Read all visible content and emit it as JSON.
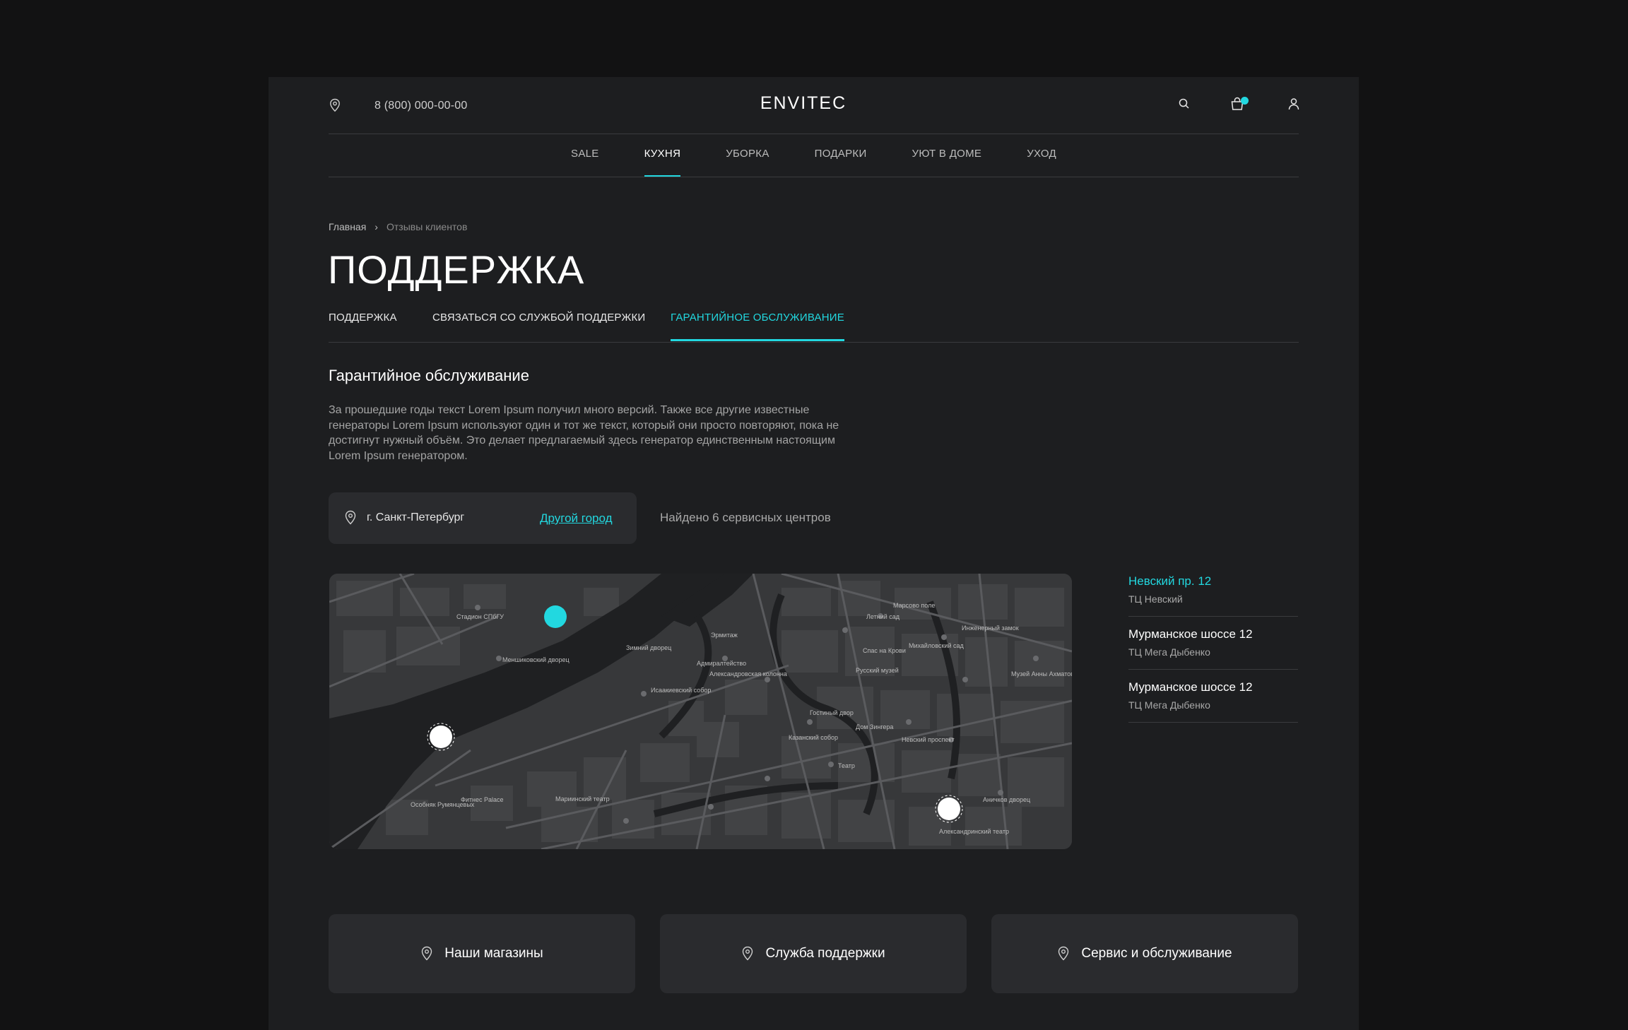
{
  "header": {
    "phone": "8 (800) 000-00-00",
    "logo": "ENVITEC",
    "location_icon": "map-pin-icon",
    "search_icon": "search-icon",
    "cart_icon": "shopping-bag-icon",
    "user_icon": "user-icon"
  },
  "nav": {
    "items": [
      {
        "label": "SALE",
        "active": false
      },
      {
        "label": "КУХНЯ",
        "active": true
      },
      {
        "label": "УБОРКА",
        "active": false
      },
      {
        "label": "ПОДАРКИ",
        "active": false
      },
      {
        "label": "УЮТ В ДОМЕ",
        "active": false
      },
      {
        "label": "УХОД",
        "active": false
      }
    ]
  },
  "breadcrumb": {
    "home": "Главная",
    "separator": "›",
    "current": "Отзывы клиентов"
  },
  "page_title": "ПОДДЕРЖКА",
  "tabs": [
    {
      "label": "ПОДДЕРЖКА",
      "active": false
    },
    {
      "label": "СВЯЗАТЬСЯ СО СЛУЖБОЙ ПОДДЕРЖКИ",
      "active": false
    },
    {
      "label": "ГАРАНТИЙНОЕ ОБСЛУЖИВАНИЕ",
      "active": true
    }
  ],
  "section": {
    "title": "Гарантийное обслуживание",
    "description": "За прошедшие годы текст Lorem Ipsum получил много версий. Также все другие известные генераторы Lorem Ipsum используют один и тот же текст, который они просто повторяют, пока не достигнут нужный объём. Это делает предлагаемый здесь генератор единственным настоящим Lorem Ipsum генератором."
  },
  "city_selector": {
    "city": "г. Санкт-Петербург",
    "change_link": "Другой город",
    "found_text": "Найдено 6 сервисных центров"
  },
  "map": {
    "labels": [
      "Стадион СПбГУ",
      "Меншиковский дворец",
      "Исаакиевский собор",
      "Адмиралтейство",
      "Александровская колонна",
      "Зимний дворец",
      "Эрмитаж",
      "Михайловский сад",
      "Русский музей",
      "Гостиный двор",
      "Казанский собор",
      "Театр",
      "Александринский театр",
      "Фитнес Palace",
      "Особняк Румянцевых",
      "Мариинский театр",
      "Летний сад",
      "Марсово поле",
      "Инженерный замок",
      "Спас на Крови",
      "Невский проспект",
      "Дом Зингера",
      "Аничков дворец",
      "Музей Анны Ахматовой"
    ]
  },
  "locations": [
    {
      "name": "Невский пр. 12",
      "sub": "ТЦ Невский",
      "active": true
    },
    {
      "name": "Мурманское шоссе 12",
      "sub": "ТЦ Мега Дыбенко",
      "active": false
    },
    {
      "name": "Мурманское шоссе 12",
      "sub": "ТЦ Мега Дыбенко",
      "active": false
    }
  ],
  "cards": [
    {
      "label": "Наши магазины",
      "icon": "map-pin-icon"
    },
    {
      "label": "Служба поддержки",
      "icon": "map-pin-icon"
    },
    {
      "label": "Сервис и обслуживание",
      "icon": "map-pin-icon"
    }
  ],
  "colors": {
    "accent": "#22d8e0",
    "background": "#121213",
    "panel": "#1d1e20",
    "card": "#2a2b2e"
  }
}
